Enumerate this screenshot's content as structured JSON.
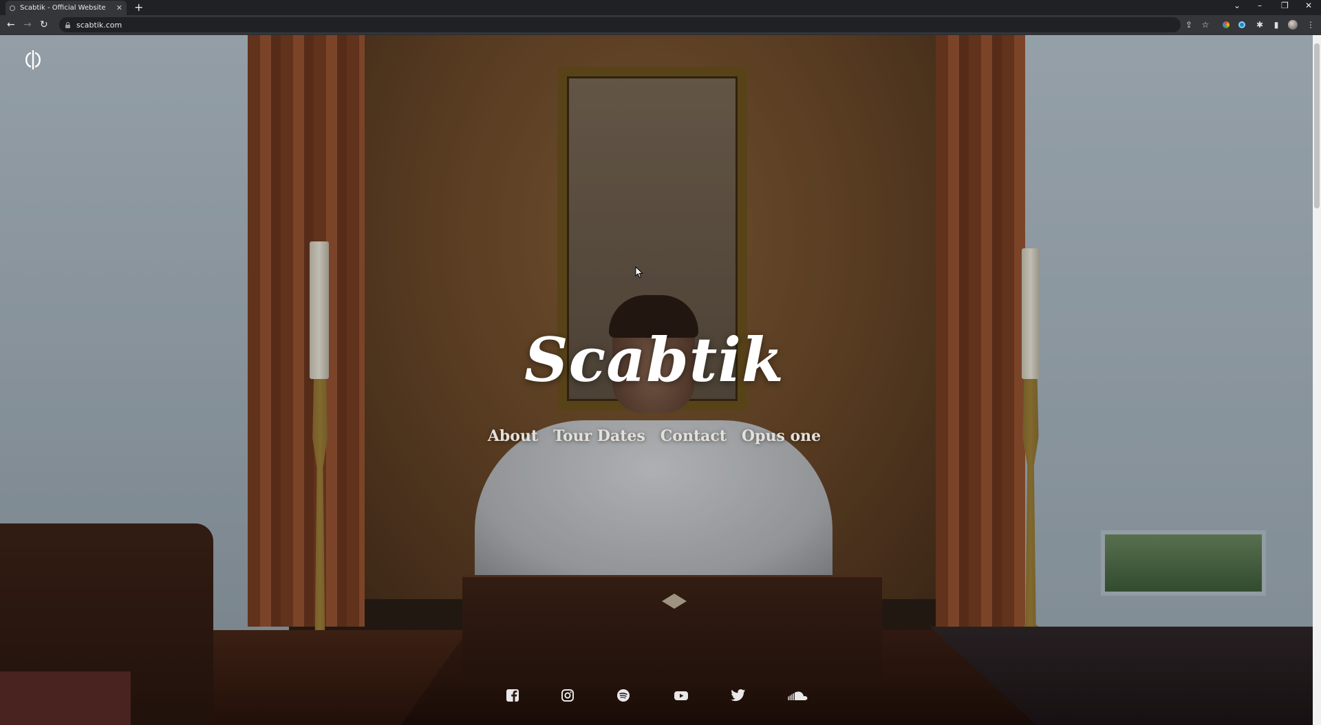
{
  "browser": {
    "tab_title": "Scabtik - Official Website",
    "url": "scabtik.com",
    "new_tab_glyph": "+",
    "close_tab_glyph": "✕"
  },
  "site": {
    "brand": "Scabtik",
    "nav": [
      {
        "label": "About"
      },
      {
        "label": "Tour Dates"
      },
      {
        "label": "Contact"
      },
      {
        "label": "Opus one"
      }
    ],
    "social": [
      {
        "icon": "facebook-icon"
      },
      {
        "icon": "instagram-icon"
      },
      {
        "icon": "spotify-icon"
      },
      {
        "icon": "youtube-icon"
      },
      {
        "icon": "twitter-icon"
      },
      {
        "icon": "soundcloud-icon"
      }
    ]
  }
}
